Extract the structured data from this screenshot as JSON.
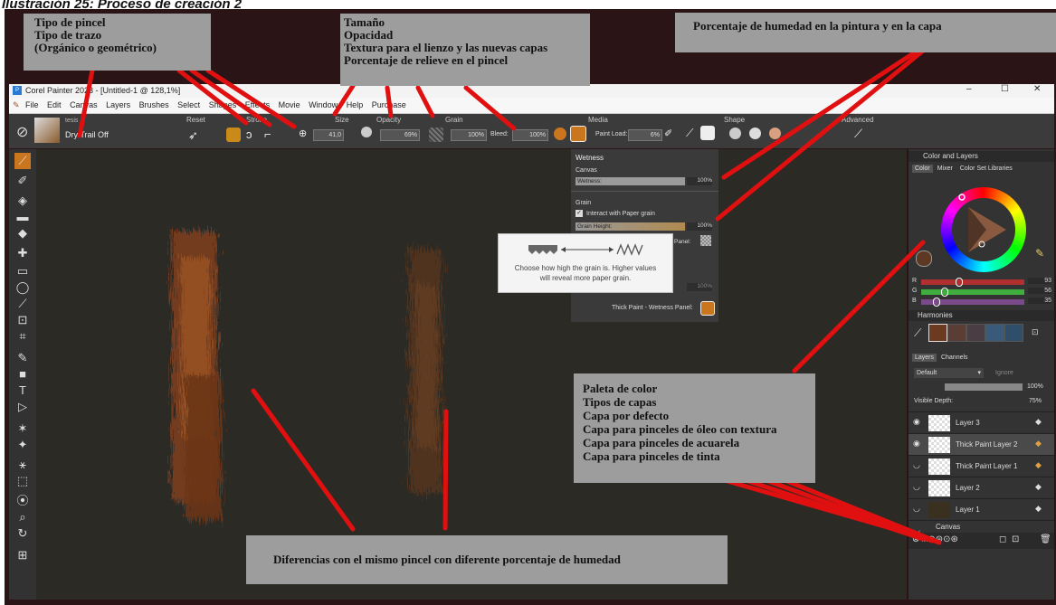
{
  "caption": "Ilustración 25: Proceso de creación 2",
  "window": {
    "title": "Corel Painter 2023 - [Untitled-1 @ 128,1%]",
    "controls": [
      "–",
      "☐",
      "✕"
    ]
  },
  "menu": [
    "File",
    "Edit",
    "Canvas",
    "Layers",
    "Brushes",
    "Select",
    "Shapes",
    "Effects",
    "Movie",
    "Window",
    "Help",
    "Purchase"
  ],
  "property_bar": {
    "brush_category": "tesis",
    "brush_variant": "Dry Trail Off",
    "sections": [
      "Reset",
      "Stroke",
      "Size",
      "Opacity",
      "Grain",
      "Media",
      "Shape",
      "Advanced"
    ],
    "size_value": "41,0",
    "opacity_value": "69%",
    "grain_value": "100%",
    "bleed_label": "Bleed:",
    "bleed_value": "100%",
    "paint_load_label": "Paint Load:",
    "paint_load_value": "6%"
  },
  "wetness_panel": {
    "title": "Wetness",
    "canvas_label": "Canvas",
    "wetness_label": "Wetness:",
    "wetness_value": "100%",
    "wetness_level": 1.0,
    "grain_label": "Grain",
    "interact_label": "Interact with Paper grain",
    "interact_checked": true,
    "grain_height_label": "Grain Height:",
    "grain_height_value": "100%",
    "grain_height_level": 1.0,
    "panel_label": "Panel:",
    "lower_value": "100%",
    "footer_label": "Thick Paint - Wetness Panel:"
  },
  "tooltip": {
    "line1": "Choose how high the grain is. Higher values",
    "line2": "will reveal more paper grain."
  },
  "right_panel": {
    "color_and_layers_title": "Color and Layers",
    "color_tabs": [
      "Color",
      "Mixer",
      "Color Set Libraries"
    ],
    "rgb": [
      {
        "channel": "R",
        "value": "93",
        "color": "#b03030",
        "level": 0.36
      },
      {
        "channel": "G",
        "value": "56",
        "color": "#3fae3f",
        "level": 0.22
      },
      {
        "channel": "B",
        "value": "35",
        "color": "#7a4a8a",
        "level": 0.14
      }
    ],
    "harmonies_title": "Harmonies",
    "harmony_swatches": [
      "#6b3a20",
      "#5a3d35",
      "#4a3e44",
      "#3a5a7a",
      "#2f4e6c"
    ],
    "layers_tabs": [
      "Layers",
      "Channels"
    ],
    "composite_method": "Default",
    "ignore_label": "Ignore",
    "opacity_value": "100%",
    "visible_depth_label": "Visible Depth:",
    "visible_depth_value": "75%",
    "layers": [
      "Layer 3",
      "Thick Paint Layer 2",
      "Thick Paint Layer 1",
      "Layer 2",
      "Layer 1",
      "Canvas"
    ]
  },
  "annotations": {
    "brush_type": [
      "Tipo de pincel",
      "Tipo de trazo",
      "(Orgánico o geométrico)"
    ],
    "size_group": [
      "Tamaño",
      "Opacidad",
      "Textura para el lienzo y las nuevas capas",
      "Porcentaje de relieve en el pincel"
    ],
    "wetness": "Porcentaje de humedad en la pintura y en la capa",
    "palette": [
      "Paleta de color",
      "Tipos de capas",
      "Capa por defecto",
      "Capa para pinceles de óleo con textura",
      "Capa para pinceles de acuarela",
      "Capa para pinceles de tinta"
    ],
    "differences": "Diferencias con el mismo pincel con diferente porcentaje de humedad"
  },
  "colors": {
    "annotation_bg": "#9d9d9d",
    "arrow_red": "#e01010",
    "paint_brown": "#8a4a22",
    "canvas_bg": "#2c2a24",
    "outer_bg": "#2a1416"
  }
}
